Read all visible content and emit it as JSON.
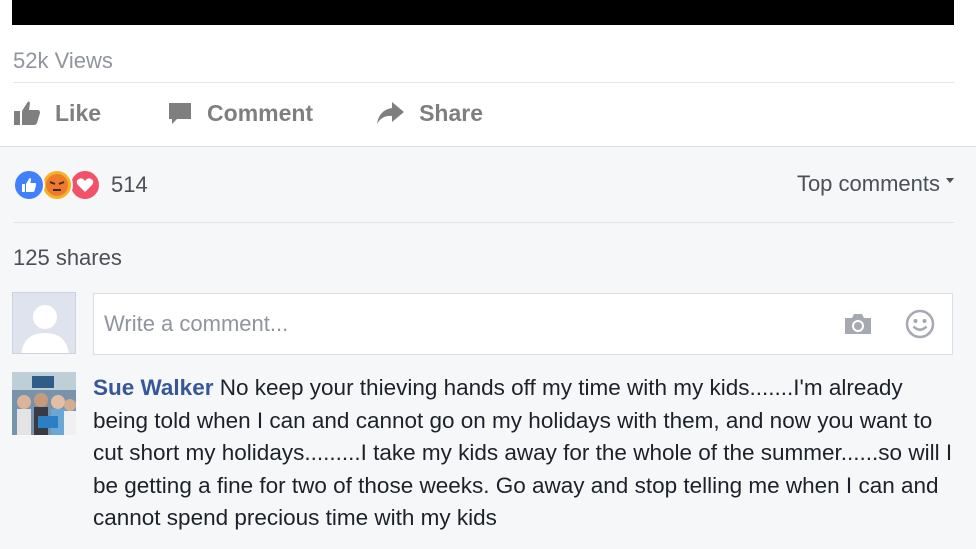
{
  "post": {
    "views": "52k Views",
    "actions": {
      "like": "Like",
      "comment": "Comment",
      "share": "Share"
    },
    "reactions_count": "514",
    "sort_label": "Top comments",
    "shares": "125 shares"
  },
  "composer": {
    "placeholder": "Write a comment..."
  },
  "comment": {
    "author": "Sue Walker",
    "text": "No keep your thieving hands off my time with my kids.......I'm already being told when I can and cannot go on my holidays with them, and now you want to cut short my holidays.........I take my kids away for the whole of the summer......so will I be getting a fine for two of those weeks. Go away and stop telling me when I can and cannot spend precious time with my kids"
  },
  "colors": {
    "link": "#365899",
    "muted": "#90949c",
    "action": "#7f7f7f",
    "like_reaction": "#4080ff",
    "angry_reaction": "#f7b125",
    "love_reaction": "#f25268"
  },
  "icons": [
    "thumbs-up-icon",
    "comment-bubble-icon",
    "share-arrow-icon",
    "like-reaction-icon",
    "angry-reaction-icon",
    "love-reaction-icon",
    "caret-down-icon",
    "camera-icon",
    "smiley-icon",
    "default-avatar-icon"
  ]
}
